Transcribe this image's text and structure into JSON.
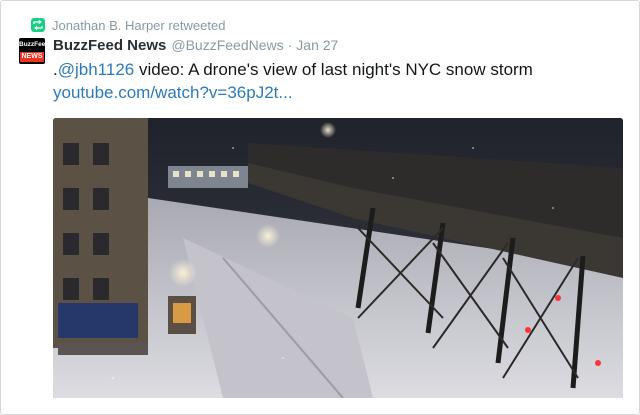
{
  "retweet": {
    "icon": "retweet-icon",
    "text": "Jonathan B. Harper retweeted"
  },
  "tweet": {
    "avatar": {
      "line1": "BuzzFeed",
      "line2": "NEWS"
    },
    "author_name": "BuzzFeed News",
    "handle": "@BuzzFeedNews",
    "separator": "·",
    "timestamp": "Jan 27",
    "text_prefix": ".",
    "mention": "@jbh1126",
    "text_body": " video: A drone's view of last night's NYC snow storm",
    "link": "youtube.com/watch?v=36pJ2t..."
  },
  "colors": {
    "link": "#2b7bb9",
    "muted": "#8899a6",
    "retweet_green": "#19cf86",
    "text": "#14171a"
  }
}
